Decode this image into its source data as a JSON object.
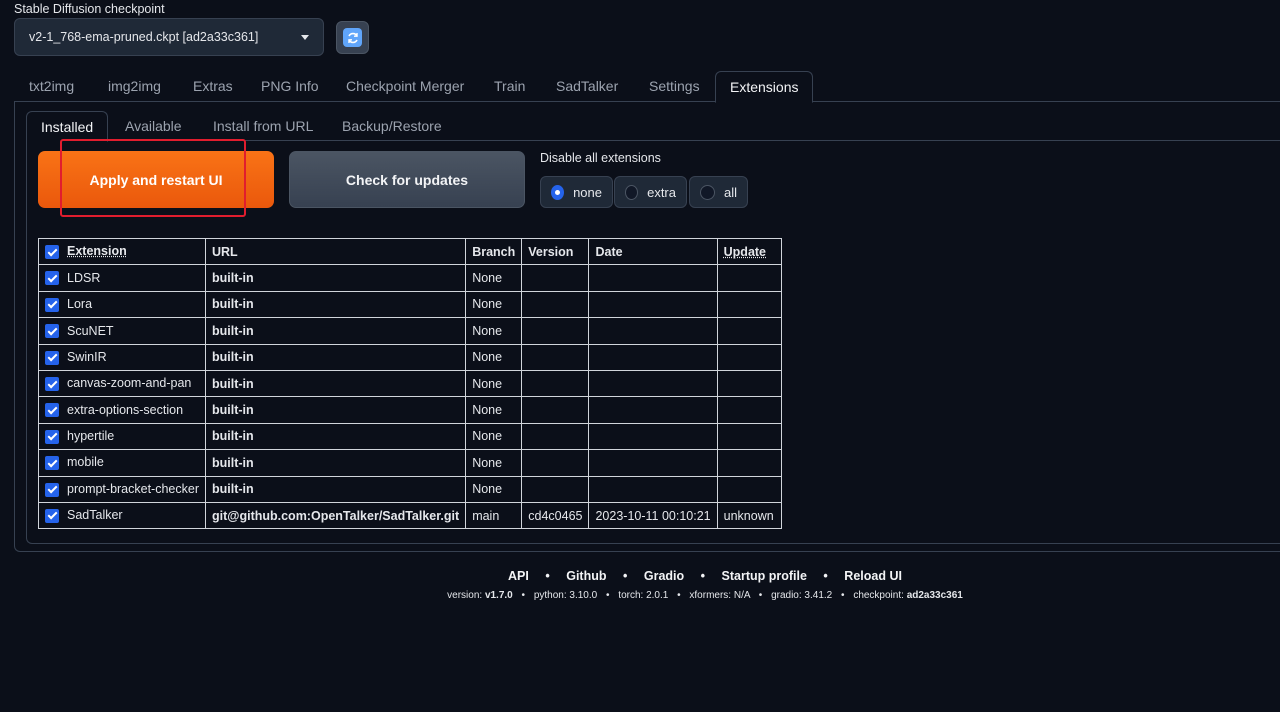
{
  "checkpoint": {
    "label": "Stable Diffusion checkpoint",
    "value": "v2-1_768-ema-pruned.ckpt [ad2a33c361]"
  },
  "main_tabs": [
    {
      "label": "txt2img"
    },
    {
      "label": "img2img"
    },
    {
      "label": "Extras"
    },
    {
      "label": "PNG Info"
    },
    {
      "label": "Checkpoint Merger"
    },
    {
      "label": "Train"
    },
    {
      "label": "SadTalker"
    },
    {
      "label": "Settings"
    },
    {
      "label": "Extensions"
    }
  ],
  "sub_tabs": [
    {
      "label": "Installed"
    },
    {
      "label": "Available"
    },
    {
      "label": "Install from URL"
    },
    {
      "label": "Backup/Restore"
    }
  ],
  "actions": {
    "apply_label": "Apply and restart UI",
    "check_label": "Check for updates"
  },
  "disable": {
    "label": "Disable all extensions",
    "options": [
      "none",
      "extra",
      "all"
    ],
    "selected": "none"
  },
  "table": {
    "headers": [
      "Extension",
      "URL",
      "Branch",
      "Version",
      "Date",
      "Update"
    ],
    "rows": [
      {
        "name": "LDSR",
        "url": "built-in",
        "branch": "None",
        "version": "",
        "date": "",
        "update": ""
      },
      {
        "name": "Lora",
        "url": "built-in",
        "branch": "None",
        "version": "",
        "date": "",
        "update": ""
      },
      {
        "name": "ScuNET",
        "url": "built-in",
        "branch": "None",
        "version": "",
        "date": "",
        "update": ""
      },
      {
        "name": "SwinIR",
        "url": "built-in",
        "branch": "None",
        "version": "",
        "date": "",
        "update": ""
      },
      {
        "name": "canvas-zoom-and-pan",
        "url": "built-in",
        "branch": "None",
        "version": "",
        "date": "",
        "update": ""
      },
      {
        "name": "extra-options-section",
        "url": "built-in",
        "branch": "None",
        "version": "",
        "date": "",
        "update": ""
      },
      {
        "name": "hypertile",
        "url": "built-in",
        "branch": "None",
        "version": "",
        "date": "",
        "update": ""
      },
      {
        "name": "mobile",
        "url": "built-in",
        "branch": "None",
        "version": "",
        "date": "",
        "update": ""
      },
      {
        "name": "prompt-bracket-checker",
        "url": "built-in",
        "branch": "None",
        "version": "",
        "date": "",
        "update": ""
      },
      {
        "name": "SadTalker",
        "url": "git@github.com:OpenTalker/SadTalker.git",
        "branch": "main",
        "version": "cd4c0465",
        "date": "2023-10-11 00:10:21",
        "update": "unknown"
      }
    ]
  },
  "footer": {
    "links": [
      "API",
      "Github",
      "Gradio",
      "Startup profile",
      "Reload UI"
    ],
    "separator": "•",
    "version_label": "version:",
    "version": "v1.7.0",
    "python": "python: 3.10.0",
    "torch": "torch: 2.0.1",
    "xformers": "xformers: N/A",
    "gradio": "gradio: 3.41.2",
    "checkpoint_label": "checkpoint:",
    "checkpoint": "ad2a33c361"
  },
  "colors": {
    "background": "#0b0f19",
    "primary": "#f97316",
    "checkbox": "#2563eb",
    "highlight_box": "#e11d2e"
  }
}
